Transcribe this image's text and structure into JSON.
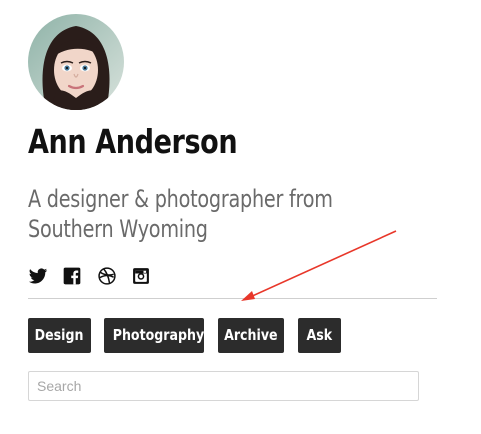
{
  "profile": {
    "name": "Ann Anderson",
    "tagline": "A designer & photographer from Southern Wyoming"
  },
  "social": [
    {
      "icon": "twitter-icon"
    },
    {
      "icon": "facebook-icon"
    },
    {
      "icon": "dribbble-icon"
    },
    {
      "icon": "instagram-icon"
    }
  ],
  "nav": {
    "design_label": "Design",
    "photography_label": "Photography",
    "archive_label": "Archive",
    "ask_label": "Ask"
  },
  "search": {
    "placeholder": "Search"
  },
  "colors": {
    "button_background": "#2c2c2c",
    "button_text": "#ffffff",
    "divider": "#cfcfcf",
    "tagline": "#6a6a6a",
    "annotation_arrow": "#e8372a"
  }
}
